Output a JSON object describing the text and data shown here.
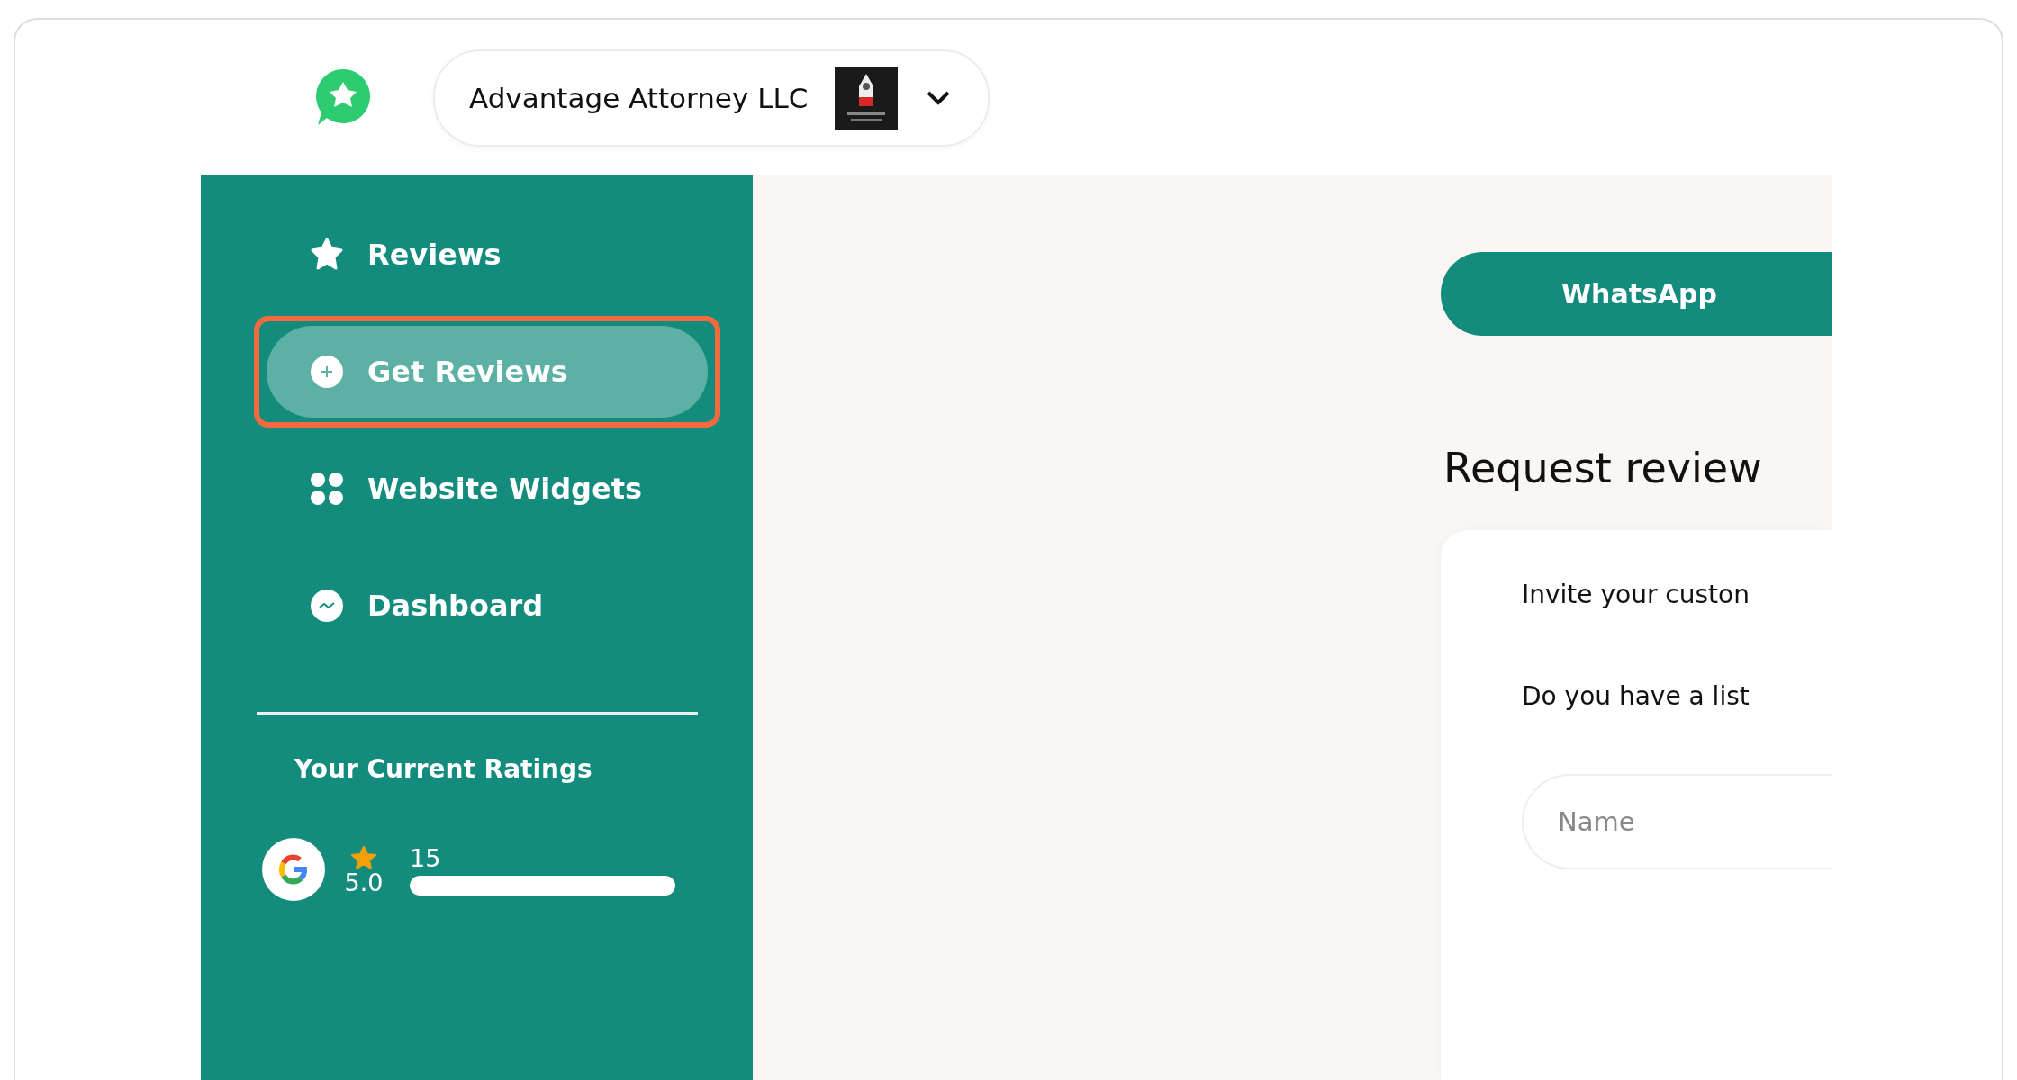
{
  "header": {
    "company": {
      "name": "Advantage Attorney LLC"
    }
  },
  "sidebar": {
    "items": [
      {
        "label": "Reviews",
        "kind": "star",
        "selected": false,
        "highlighted": false
      },
      {
        "label": "Get Reviews",
        "kind": "plus",
        "selected": true,
        "highlighted": true
      },
      {
        "label": "Website Widgets",
        "kind": "grid",
        "selected": false,
        "highlighted": false
      },
      {
        "label": "Dashboard",
        "kind": "chart",
        "selected": false,
        "highlighted": false
      }
    ],
    "ratings": {
      "title": "Your Current Ratings",
      "sources": [
        {
          "kind": "google",
          "score": "5.0",
          "count": "15",
          "level": 1
        }
      ]
    }
  },
  "content": {
    "channel_button": "WhatsApp",
    "title": "Request review",
    "card": {
      "intro": "Invite your custon",
      "question": "Do you have a list",
      "name_field": {
        "placeholder": "Name"
      }
    }
  }
}
